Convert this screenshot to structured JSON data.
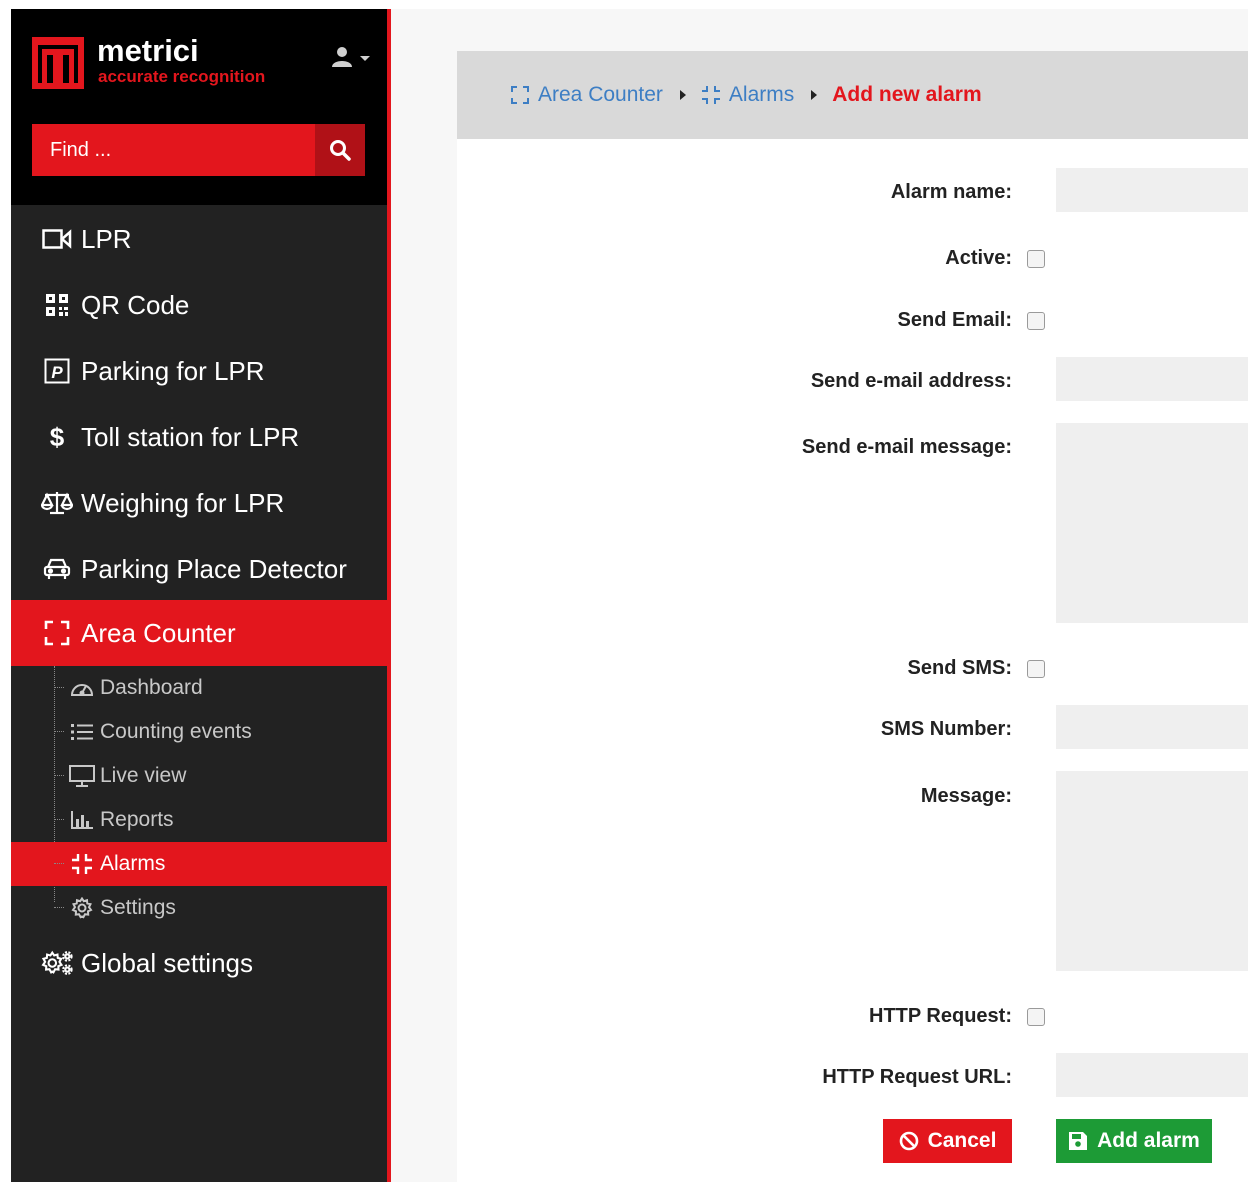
{
  "brand": {
    "name": "metrici",
    "tagline": "accurate recognition",
    "accent_color": "#e3161d"
  },
  "search": {
    "placeholder": "Find ..."
  },
  "nav": {
    "items": [
      {
        "label": "LPR",
        "icon": "camera-icon"
      },
      {
        "label": "QR Code",
        "icon": "qrcode-icon"
      },
      {
        "label": "Parking for LPR",
        "icon": "parking-icon"
      },
      {
        "label": "Toll station for LPR",
        "icon": "dollar-icon"
      },
      {
        "label": "Weighing for LPR",
        "icon": "scale-icon"
      },
      {
        "label": "Parking Place Detector",
        "icon": "car-icon"
      },
      {
        "label": "Area Counter",
        "icon": "expand-icon",
        "active": true
      },
      {
        "label": "Global settings",
        "icon": "gears-icon"
      }
    ],
    "sub_items": [
      {
        "label": "Dashboard",
        "icon": "speedometer-icon"
      },
      {
        "label": "Counting events",
        "icon": "list-icon"
      },
      {
        "label": "Live view",
        "icon": "monitor-icon"
      },
      {
        "label": "Reports",
        "icon": "bar-chart-icon"
      },
      {
        "label": "Alarms",
        "icon": "compress-icon",
        "active": true
      },
      {
        "label": "Settings",
        "icon": "gear-icon"
      }
    ]
  },
  "breadcrumb": {
    "items": [
      "Area Counter",
      "Alarms"
    ],
    "current": "Add new alarm"
  },
  "form": {
    "alarm_name": "Alarm name:",
    "active": "Active:",
    "send_email": "Send Email:",
    "email_address": "Send e-mail address:",
    "email_message": "Send e-mail message:",
    "send_sms": "Send SMS:",
    "sms_number": "SMS Number:",
    "message": "Message:",
    "http_request": "HTTP Request:",
    "http_url": "HTTP Request URL:"
  },
  "buttons": {
    "cancel": "Cancel",
    "add": "Add alarm",
    "cancel_color": "#e3161d",
    "add_color": "#1d9b36"
  }
}
